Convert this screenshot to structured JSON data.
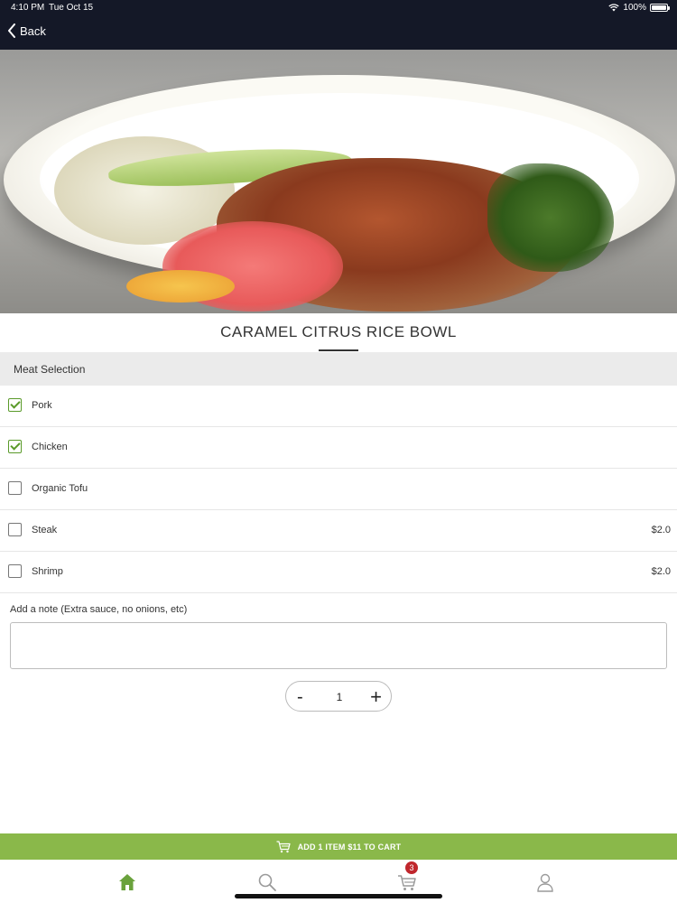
{
  "status_bar": {
    "time": "4:10 PM",
    "date": "Tue Oct 15",
    "battery": "100%",
    "battery_level": 1.0
  },
  "nav": {
    "back_label": "Back"
  },
  "item": {
    "title": "CARAMEL CITRUS RICE BOWL"
  },
  "section": {
    "title": "Meat Selection",
    "options": [
      {
        "label": "Pork",
        "checked": true,
        "price": ""
      },
      {
        "label": "Chicken",
        "checked": true,
        "price": ""
      },
      {
        "label": "Organic Tofu",
        "checked": false,
        "price": ""
      },
      {
        "label": "Steak",
        "checked": false,
        "price": "$2.0"
      },
      {
        "label": "Shrimp",
        "checked": false,
        "price": "$2.0"
      }
    ]
  },
  "note": {
    "label": "Add a note (Extra sauce, no onions, etc)",
    "value": ""
  },
  "stepper": {
    "minus": "-",
    "quantity": "1",
    "plus": "+"
  },
  "cart_bar": {
    "label": "ADD 1 ITEM $11 TO CART"
  },
  "tabbar": {
    "active_color": "#6aa23c",
    "icons": [
      "home-icon",
      "search-icon",
      "cart-icon",
      "profile-icon"
    ],
    "cart_badge": "3"
  },
  "colors": {
    "header": "#141827",
    "accent": "#8ab84a",
    "badge": "#c0272d"
  }
}
